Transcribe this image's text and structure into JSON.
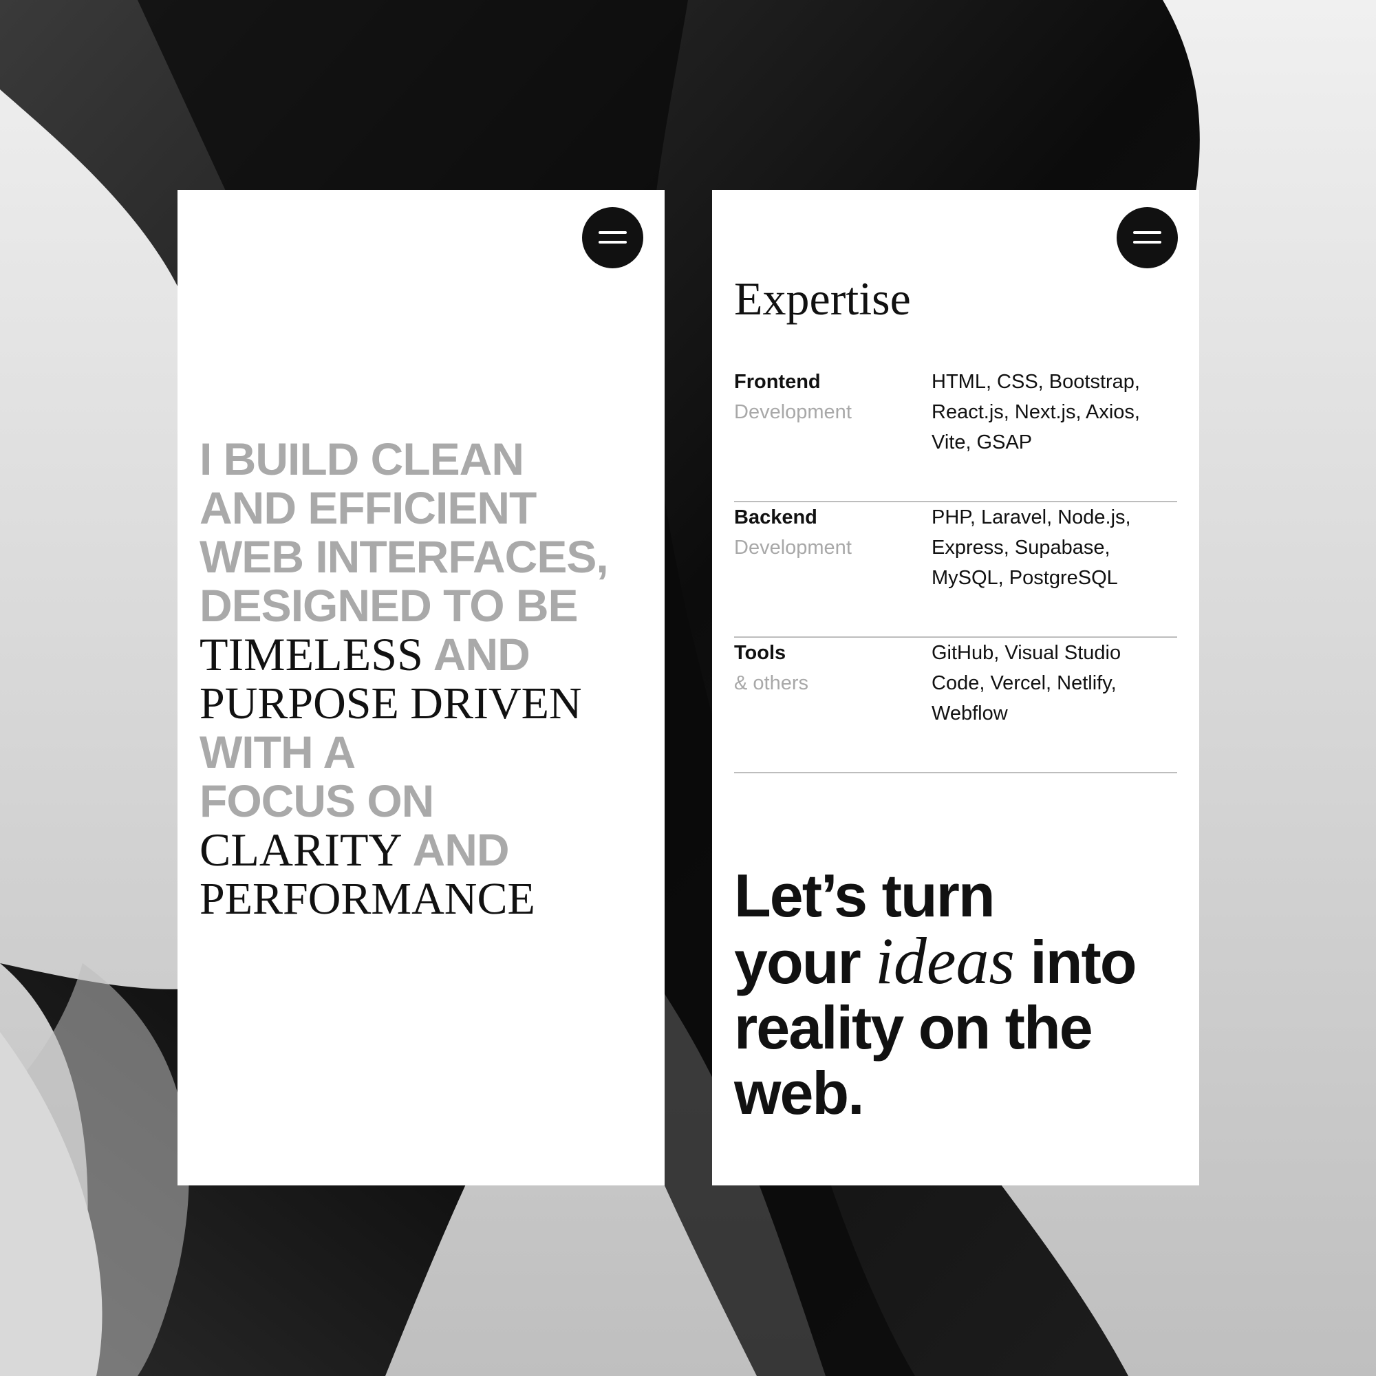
{
  "statement": {
    "line1": "I BUILD CLEAN",
    "line2": "AND EFFICIENT",
    "line3": "WEB INTERFACES,",
    "line4": "DESIGNED TO BE",
    "line5_serif": "TIMELESS",
    "line5_sans": " AND",
    "line6_serif": "PURPOSE DRIVEN",
    "line7": "WITH A",
    "line8": "FOCUS ON",
    "line9_serif": "CLARITY",
    "line9_sans": " AND",
    "line10_serif": "PERFORMANCE"
  },
  "expertise": {
    "title": "Expertise",
    "rows": [
      {
        "title": "Frontend",
        "subtitle": "Development",
        "items_line1": "HTML, CSS, Bootstrap,",
        "items_line2": "React.js, Next.js, Axios,",
        "items_line3": "Vite, GSAP"
      },
      {
        "title": "Backend",
        "subtitle": "Development",
        "items_line1": "PHP, Laravel, Node.js,",
        "items_line2": "Express, Supabase,",
        "items_line3": "MySQL, PostgreSQL"
      },
      {
        "title": "Tools",
        "subtitle": "& others",
        "items_line1": "GitHub, Visual Studio",
        "items_line2": "Code, Vercel, Netlify,",
        "items_line3": "Webflow"
      }
    ]
  },
  "cta": {
    "line1": "Let’s turn",
    "line2_pre": "your ",
    "line2_italic": "ideas",
    "line2_post": " into",
    "line3": "reality on the",
    "line4": "web."
  },
  "icons": {
    "menu": "hamburger-menu-icon"
  },
  "colors": {
    "text_dark": "#111111",
    "text_muted": "#a9a9a9",
    "divider": "#bdbdbd",
    "card": "#ffffff",
    "menu_button": "#111111"
  }
}
